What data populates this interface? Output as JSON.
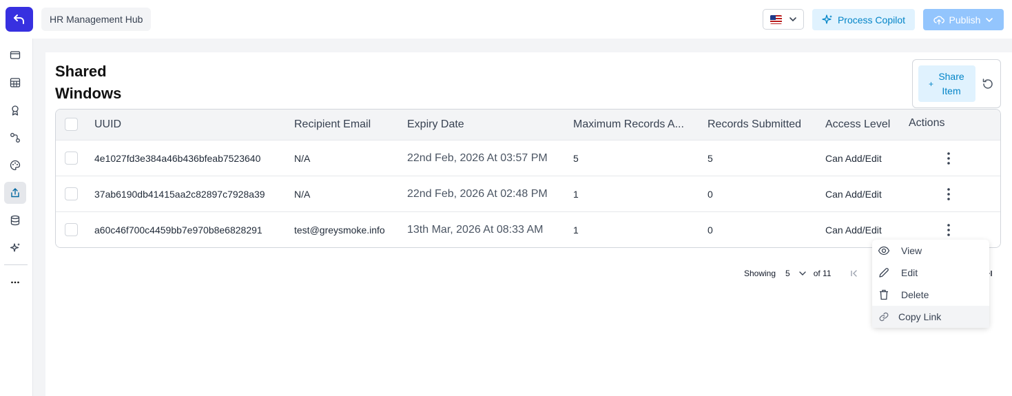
{
  "header": {
    "app_name": "HR Management Hub",
    "copilot_label": "Process Copilot",
    "publish_label": "Publish",
    "accent_color": "#3730e0"
  },
  "sidebar": {
    "items": [
      {
        "icon": "window-icon"
      },
      {
        "icon": "table-icon"
      },
      {
        "icon": "badge-icon"
      },
      {
        "icon": "flow-icon"
      },
      {
        "icon": "palette-icon"
      },
      {
        "icon": "share-upload-icon",
        "active": true
      },
      {
        "icon": "database-icon"
      },
      {
        "icon": "sparkle-icon"
      },
      {
        "icon": "more-icon"
      }
    ]
  },
  "page": {
    "title": "Shared Windows",
    "share_button": "Share Item"
  },
  "table": {
    "columns": [
      "UUID",
      "Recipient Email",
      "Expiry Date",
      "Maximum Records A...",
      "Records Submitted",
      "Access Level",
      "Actions"
    ],
    "rows": [
      {
        "uuid": "4e1027fd3e384a46b436bfeab7523640",
        "email": "N/A",
        "expiry": "22nd Feb, 2026  At  03:57 PM",
        "max_records": "5",
        "submitted": "5",
        "access": "Can Add/Edit"
      },
      {
        "uuid": "37ab6190db41415aa2c82897c7928a39",
        "email": "N/A",
        "expiry": "22nd Feb, 2026  At  02:48 PM",
        "max_records": "1",
        "submitted": "0",
        "access": "Can Add/Edit"
      },
      {
        "uuid": "a60c46f700c4459bb7e970b8e6828291",
        "email": "test@greysmoke.info",
        "expiry": "13th Mar, 2026  At  08:33 AM",
        "max_records": "1",
        "submitted": "0",
        "access": "Can Add/Edit"
      }
    ]
  },
  "pagination": {
    "showing_label": "Showing",
    "page_size": "5",
    "of_label": "of 11"
  },
  "context_menu": {
    "items": [
      {
        "label": "View",
        "icon": "eye-icon"
      },
      {
        "label": "Edit",
        "icon": "pencil-icon"
      },
      {
        "label": "Delete",
        "icon": "trash-icon"
      },
      {
        "label": "Copy Link",
        "icon": "link-icon"
      }
    ]
  }
}
